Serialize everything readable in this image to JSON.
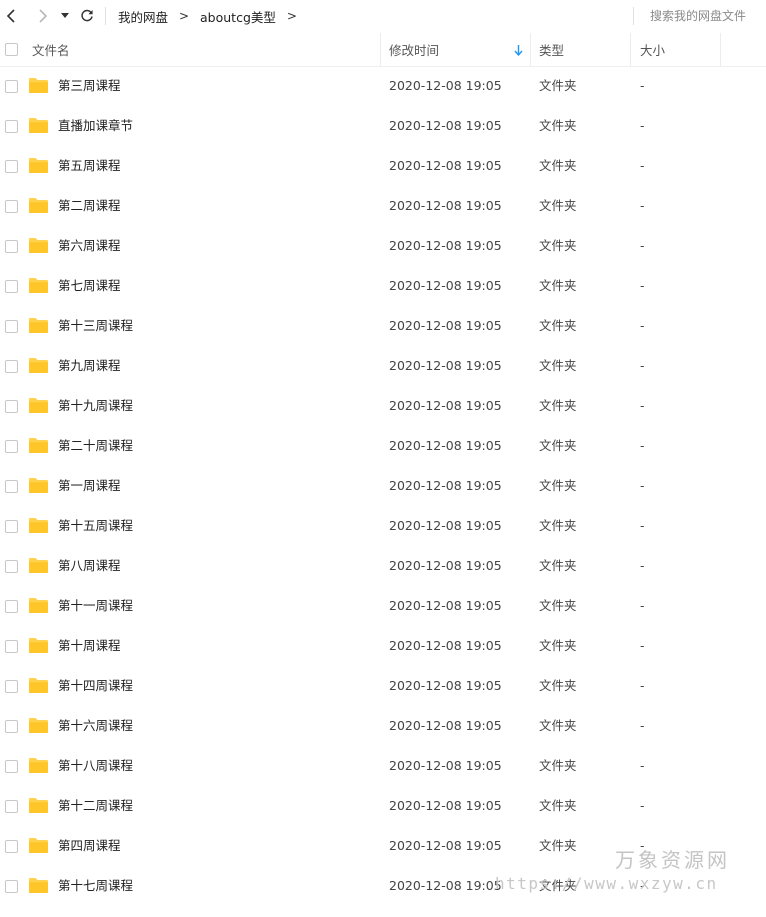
{
  "toolbar": {
    "breadcrumb": [
      "我的网盘",
      "aboutcg美型"
    ],
    "crumb_separator": ">",
    "search_placeholder": "搜索我的网盘文件"
  },
  "columns": {
    "name": "文件名",
    "mtime": "修改时间",
    "type": "类型",
    "size": "大小"
  },
  "rows": [
    {
      "name": "第三周课程",
      "mtime": "2020-12-08 19:05",
      "type": "文件夹",
      "size": "-"
    },
    {
      "name": "直播加课章节",
      "mtime": "2020-12-08 19:05",
      "type": "文件夹",
      "size": "-"
    },
    {
      "name": "第五周课程",
      "mtime": "2020-12-08 19:05",
      "type": "文件夹",
      "size": "-"
    },
    {
      "name": "第二周课程",
      "mtime": "2020-12-08 19:05",
      "type": "文件夹",
      "size": "-"
    },
    {
      "name": "第六周课程",
      "mtime": "2020-12-08 19:05",
      "type": "文件夹",
      "size": "-"
    },
    {
      "name": "第七周课程",
      "mtime": "2020-12-08 19:05",
      "type": "文件夹",
      "size": "-"
    },
    {
      "name": "第十三周课程",
      "mtime": "2020-12-08 19:05",
      "type": "文件夹",
      "size": "-"
    },
    {
      "name": "第九周课程",
      "mtime": "2020-12-08 19:05",
      "type": "文件夹",
      "size": "-"
    },
    {
      "name": "第十九周课程",
      "mtime": "2020-12-08 19:05",
      "type": "文件夹",
      "size": "-"
    },
    {
      "name": "第二十周课程",
      "mtime": "2020-12-08 19:05",
      "type": "文件夹",
      "size": "-"
    },
    {
      "name": "第一周课程",
      "mtime": "2020-12-08 19:05",
      "type": "文件夹",
      "size": "-"
    },
    {
      "name": "第十五周课程",
      "mtime": "2020-12-08 19:05",
      "type": "文件夹",
      "size": "-"
    },
    {
      "name": "第八周课程",
      "mtime": "2020-12-08 19:05",
      "type": "文件夹",
      "size": "-"
    },
    {
      "name": "第十一周课程",
      "mtime": "2020-12-08 19:05",
      "type": "文件夹",
      "size": "-"
    },
    {
      "name": "第十周课程",
      "mtime": "2020-12-08 19:05",
      "type": "文件夹",
      "size": "-"
    },
    {
      "name": "第十四周课程",
      "mtime": "2020-12-08 19:05",
      "type": "文件夹",
      "size": "-"
    },
    {
      "name": "第十六周课程",
      "mtime": "2020-12-08 19:05",
      "type": "文件夹",
      "size": "-"
    },
    {
      "name": "第十八周课程",
      "mtime": "2020-12-08 19:05",
      "type": "文件夹",
      "size": "-"
    },
    {
      "name": "第十二周课程",
      "mtime": "2020-12-08 19:05",
      "type": "文件夹",
      "size": "-"
    },
    {
      "name": "第四周课程",
      "mtime": "2020-12-08 19:05",
      "type": "文件夹",
      "size": "-"
    },
    {
      "name": "第十七周课程",
      "mtime": "2020-12-08 19:05",
      "type": "文件夹",
      "size": "-"
    }
  ],
  "watermark": {
    "title": "万象资源网",
    "url": "https://www.wxzyw.cn"
  },
  "icons": {
    "back": "chevron-left-icon",
    "forward": "chevron-right-icon",
    "history": "caret-down-icon",
    "refresh": "refresh-icon",
    "sort": "sort-down-arrow-icon",
    "row_icon": "folder-icon"
  },
  "colors": {
    "folder": "#ffd24d",
    "sort_arrow": "#2196f3",
    "checkbox_border": "#c8c8c8"
  }
}
